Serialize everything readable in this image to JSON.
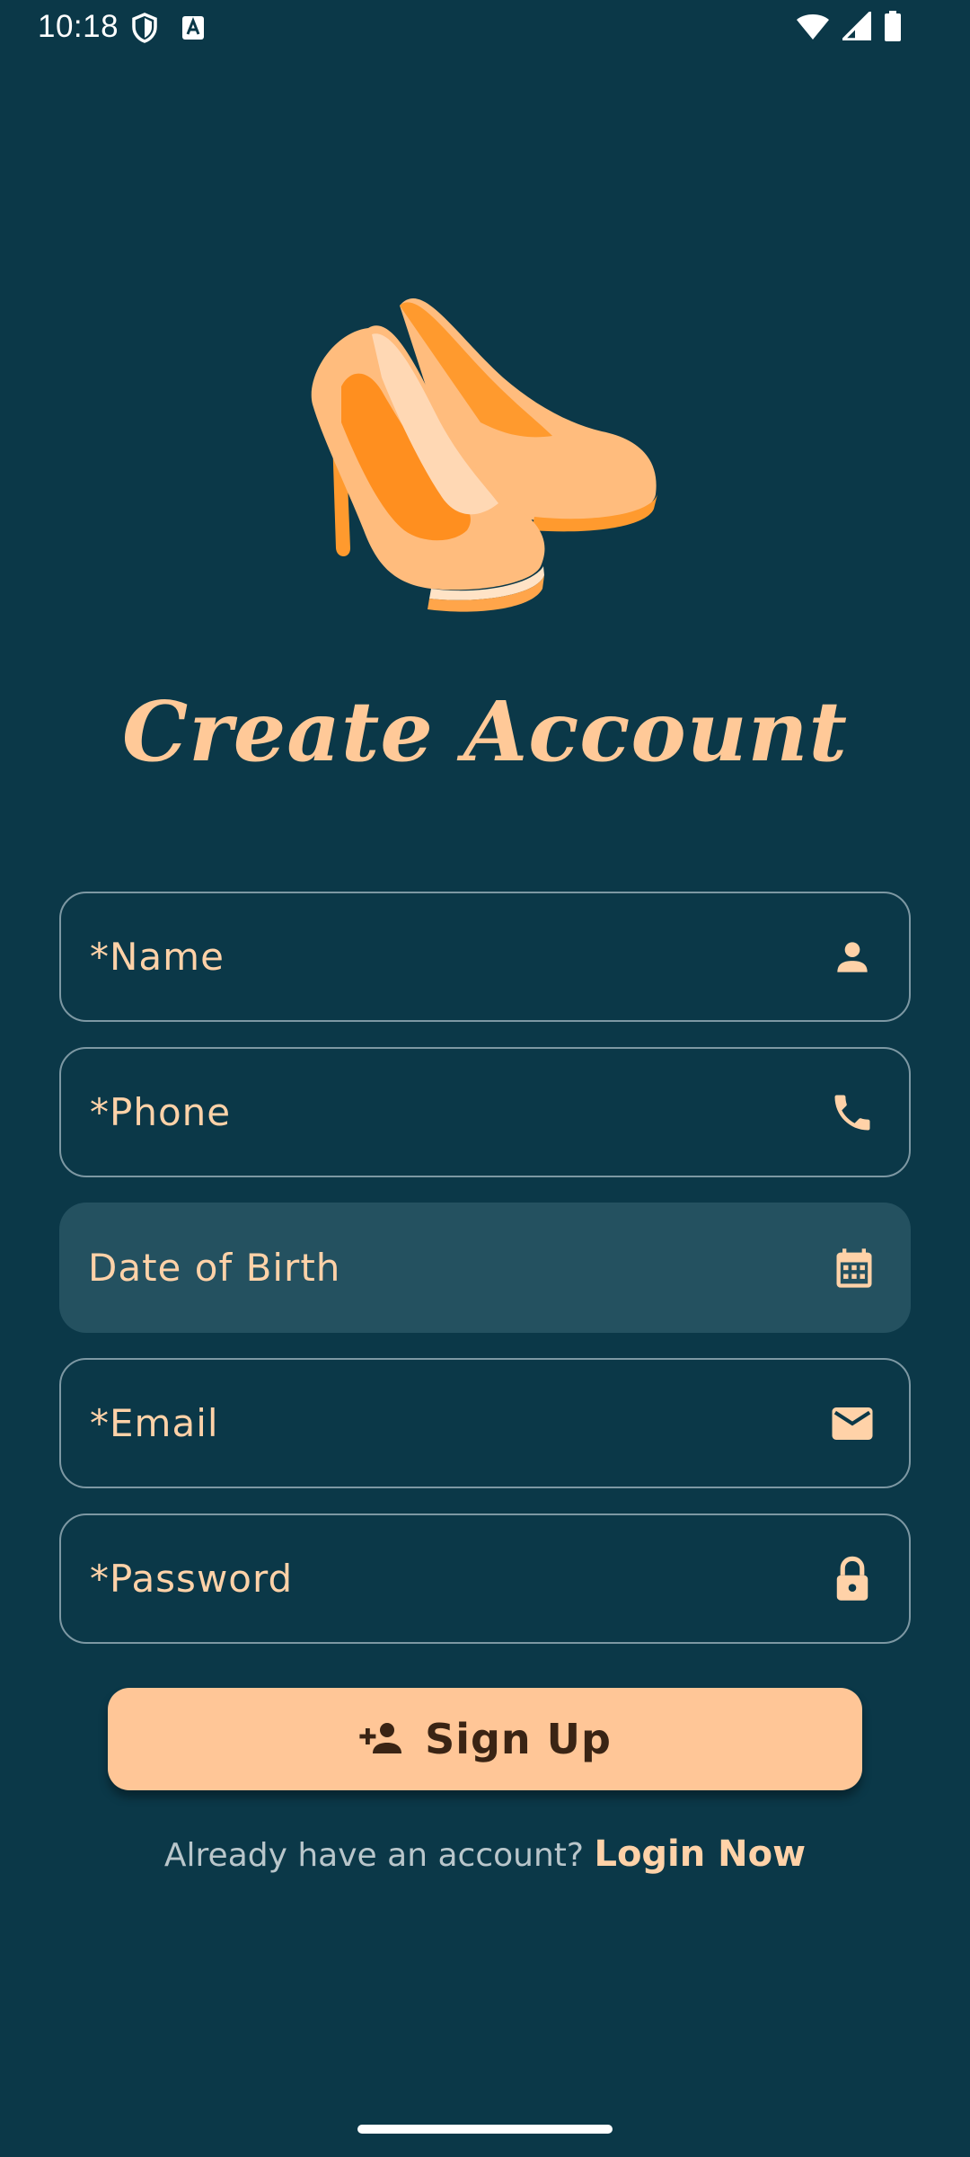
{
  "status_bar": {
    "time": "10:18",
    "left_icons": [
      "shield-icon",
      "font-a-icon"
    ],
    "right_icons": [
      "wifi-icon",
      "cellular-signal-icon",
      "battery-icon"
    ]
  },
  "illustration": {
    "icon": "high-heels-icon"
  },
  "page": {
    "title": "Create Account"
  },
  "form": {
    "fields": [
      {
        "label": "*Name",
        "icon": "person-icon"
      },
      {
        "label": "*Phone",
        "icon": "phone-icon"
      },
      {
        "label": "Date of Birth",
        "icon": "calendar-icon"
      },
      {
        "label": "*Email",
        "icon": "mail-icon"
      },
      {
        "label": "*Password",
        "icon": "lock-icon"
      }
    ],
    "submit_label": "Sign Up",
    "submit_icon": "person-add-icon"
  },
  "footer": {
    "prompt": "Already have an account?",
    "link_label": "Login Now"
  },
  "colors": {
    "background": "#0b3848",
    "accent": "#ffc697",
    "field_filled": "#245160",
    "text_accent": "#ffd2a8"
  }
}
